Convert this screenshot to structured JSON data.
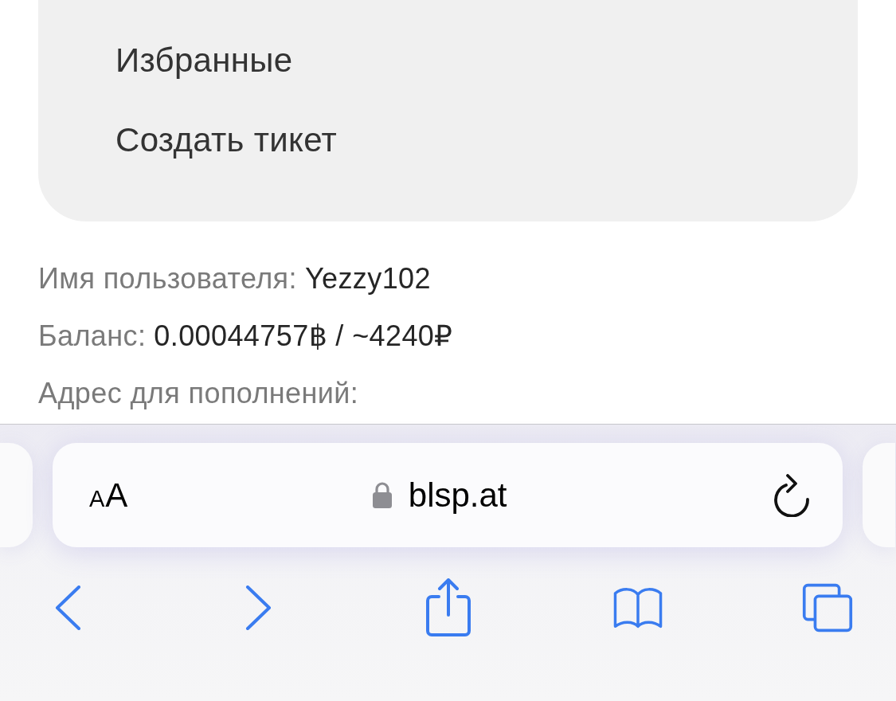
{
  "menu": {
    "items": [
      {
        "label": "Избранные"
      },
      {
        "label": "Создать тикет"
      }
    ]
  },
  "account": {
    "rows": [
      {
        "label": "Имя пользователя:",
        "value": "Yezzy102"
      },
      {
        "label": "Баланс:",
        "value": "0.00044757฿ / ~4240₽"
      },
      {
        "label": "Адрес для пополнений:"
      }
    ]
  },
  "address_bar": {
    "text_size_button": "AA",
    "secure": true,
    "url": "blsp.at"
  }
}
